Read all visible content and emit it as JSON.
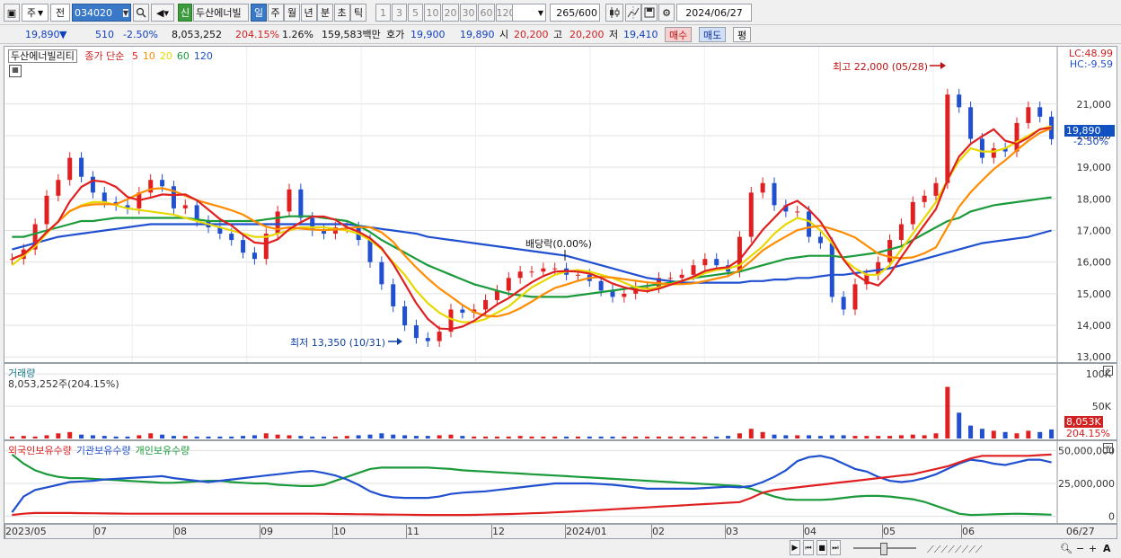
{
  "toolbar": {
    "period_week": "주",
    "prev_label": "전",
    "code": "034020",
    "new_badge": "신",
    "stock_name": "두산에너빌",
    "periods": [
      "일",
      "주",
      "월",
      "년",
      "분",
      "초",
      "틱"
    ],
    "active_period": "일",
    "intervals": [
      "1",
      "3",
      "5",
      "10",
      "20",
      "30",
      "60",
      "120"
    ],
    "count_value": "265",
    "count_max": "/600",
    "date": "2024/06/27"
  },
  "infobar": {
    "price": "19,890",
    "arrow": "▼",
    "change": "510",
    "change_pct": "-2.50%",
    "volume": "8,053,252",
    "volume_ratio": "204.15%",
    "turnover_pct": "1.26%",
    "trade_value": "159,583백만",
    "quote_label": "호가",
    "ask": "19,900",
    "bid": "19,890",
    "open_label": "시",
    "open": "20,200",
    "high_label": "고",
    "high": "20,200",
    "low_label": "저",
    "low": "19,410",
    "buy_button": "매수",
    "sell_button": "매도",
    "eval_button": "평"
  },
  "price_pane": {
    "stock_label": "두산에너빌리티",
    "legend_prefix": "종가 단순",
    "ma_labels": [
      "5",
      "10",
      "20",
      "60",
      "120"
    ],
    "ma_colors": [
      "#e02020",
      "#ff8c00",
      "#e8d800",
      "#1a9a3a",
      "#2050d0"
    ],
    "lc": "LC:48.99",
    "hc": "HC:-9.59",
    "high_annotation": "최고 22,000 (05/28)",
    "low_annotation": "최저 13,350 (10/31)",
    "dividend_annotation": "배당락(0.00%)",
    "current_price_tag": "19,890",
    "current_pct_tag": "-2.50%"
  },
  "volume_pane": {
    "title": "거래량",
    "value": "8,053,252주(204.15%)",
    "current_tag": "8,053K",
    "current_pct": "204.15%"
  },
  "holding_pane": {
    "legend": [
      "외국인보유수량",
      "기관보유수량",
      "개인보유수량"
    ],
    "colors": [
      "#e02020",
      "#2050d0",
      "#1a9a3a"
    ]
  },
  "x_labels": [
    "2023/05",
    "07",
    "08",
    "09",
    "10",
    "11",
    "12",
    "2024/01",
    "02",
    "03",
    "04",
    "05",
    "06",
    "06/27"
  ],
  "chart_data": [
    {
      "type": "line",
      "name": "price",
      "y_ticks": [
        13000,
        14000,
        15000,
        16000,
        17000,
        18000,
        19000,
        20000,
        21000
      ],
      "ylim": [
        12950,
        22700
      ],
      "close": [
        16100,
        16400,
        17200,
        18100,
        18600,
        19300,
        18700,
        18200,
        17900,
        17800,
        17700,
        18200,
        18600,
        18400,
        17700,
        17800,
        17300,
        17100,
        16900,
        16700,
        16300,
        16100,
        16900,
        17600,
        18300,
        17400,
        17000,
        16900,
        17100,
        17100,
        16700,
        16000,
        15300,
        14600,
        14000,
        13600,
        13500,
        13800,
        14500,
        14400,
        14500,
        14800,
        15100,
        15500,
        15700,
        15700,
        15800,
        15800,
        15600,
        15600,
        15400,
        15100,
        14900,
        15000,
        15200,
        15200,
        15500,
        15500,
        15600,
        15900,
        16100,
        15900,
        15700,
        16800,
        18200,
        18500,
        17800,
        17600,
        17600,
        16800,
        16600,
        14900,
        14500,
        15300,
        15600,
        16000,
        16700,
        17200,
        17900,
        18100,
        18500,
        21300,
        20900,
        19900,
        19300,
        19600,
        19500,
        20400,
        20900,
        20600,
        19890
      ],
      "ma20": [
        15900,
        16200,
        16500,
        16900,
        17300,
        17600,
        17800,
        17900,
        17900,
        17800,
        17700,
        17650,
        17600,
        17550,
        17500,
        17400,
        17300,
        17200,
        17100,
        17000,
        16900,
        16800,
        16800,
        16900,
        17000,
        17100,
        17100,
        17100,
        17050,
        17000,
        16900,
        16700,
        16400,
        16000,
        15600,
        15100,
        14700,
        14400,
        14200,
        14100,
        14100,
        14200,
        14400,
        14600,
        14900,
        15200,
        15400,
        15600,
        15700,
        15750,
        15700,
        15600,
        15500,
        15350,
        15200,
        15150,
        15200,
        15300,
        15400,
        15500,
        15650,
        15750,
        15800,
        15900,
        16200,
        16500,
        16900,
        17200,
        17400,
        17300,
        17000,
        16600,
        16100,
        15800,
        15600,
        15600,
        15900,
        16400,
        16900,
        17400,
        17900,
        18600,
        19200,
        19600,
        19500,
        19500,
        19600,
        19800,
        20000,
        20200,
        20300
      ],
      "ma60": [
        16800,
        16800,
        16900,
        17000,
        17100,
        17200,
        17300,
        17300,
        17350,
        17400,
        17400,
        17400,
        17400,
        17400,
        17400,
        17400,
        17350,
        17300,
        17300,
        17300,
        17300,
        17300,
        17350,
        17400,
        17450,
        17450,
        17450,
        17400,
        17350,
        17300,
        17150,
        16950,
        16700,
        16500,
        16300,
        16100,
        15900,
        15750,
        15600,
        15450,
        15300,
        15200,
        15100,
        15000,
        14950,
        14900,
        14900,
        14900,
        14900,
        14950,
        15000,
        15050,
        15100,
        15150,
        15200,
        15250,
        15300,
        15350,
        15400,
        15500,
        15550,
        15600,
        15650,
        15700,
        15800,
        15900,
        16000,
        16100,
        16150,
        16200,
        16200,
        16200,
        16150,
        16200,
        16250,
        16300,
        16400,
        16500,
        16700,
        16900,
        17100,
        17300,
        17400,
        17600,
        17700,
        17800,
        17850,
        17900,
        17950,
        18000,
        18050
      ],
      "ma120": [
        16400,
        16500,
        16600,
        16700,
        16800,
        16850,
        16900,
        16950,
        17000,
        17050,
        17100,
        17150,
        17200,
        17200,
        17200,
        17200,
        17200,
        17200,
        17200,
        17200,
        17200,
        17200,
        17200,
        17200,
        17200,
        17200,
        17200,
        17200,
        17200,
        17200,
        17150,
        17100,
        17050,
        17000,
        16950,
        16900,
        16800,
        16750,
        16700,
        16650,
        16600,
        16550,
        16500,
        16450,
        16400,
        16350,
        16300,
        16250,
        16200,
        16100,
        16000,
        15900,
        15800,
        15700,
        15600,
        15500,
        15450,
        15400,
        15350,
        15350,
        15350,
        15350,
        15350,
        15350,
        15400,
        15400,
        15450,
        15450,
        15500,
        15500,
        15550,
        15600,
        15600,
        15650,
        15700,
        15750,
        15800,
        15900,
        16000,
        16100,
        16200,
        16300,
        16400,
        16500,
        16600,
        16650,
        16700,
        16750,
        16800,
        16900,
        17000
      ]
    },
    {
      "type": "bar",
      "name": "volume",
      "y_ticks": [
        0,
        50000,
        100000
      ],
      "ylim": [
        0,
        110000
      ],
      "values": [
        3,
        4,
        3,
        5,
        8,
        10,
        6,
        5,
        4,
        3,
        3,
        5,
        8,
        6,
        4,
        4,
        3,
        3,
        3,
        3,
        4,
        5,
        8,
        6,
        5,
        4,
        3,
        3,
        3,
        4,
        5,
        6,
        8,
        6,
        5,
        4,
        4,
        5,
        6,
        4,
        3,
        3,
        3,
        3,
        4,
        3,
        3,
        3,
        3,
        3,
        3,
        3,
        3,
        3,
        3,
        3,
        3,
        3,
        3,
        3,
        3,
        3,
        4,
        8,
        15,
        10,
        6,
        5,
        5,
        5,
        4,
        5,
        5,
        4,
        4,
        4,
        4,
        5,
        6,
        5,
        8,
        80,
        40,
        20,
        15,
        12,
        10,
        8,
        12,
        10,
        14
      ]
    },
    {
      "type": "line",
      "name": "holdings",
      "y_ticks": [
        0,
        25000000,
        50000000
      ],
      "ylim": [
        -3000000,
        53000000
      ],
      "foreign": [
        1000000,
        2000000,
        2500000,
        2500000,
        2500000,
        2500000,
        2400000,
        2300000,
        2200000,
        2100000,
        2000000,
        2000000,
        2000000,
        2000000,
        2000000,
        2000000,
        2000000,
        2000000,
        2000000,
        2000000,
        2000000,
        2000000,
        2000000,
        2000000,
        2000000,
        2000000,
        2000000,
        1900000,
        1800000,
        1700000,
        1600000,
        1500000,
        1400000,
        1300000,
        1200000,
        1100000,
        1000000,
        1000000,
        1000000,
        1000000,
        1100000,
        1300000,
        1500000,
        1700000,
        2000000,
        2300000,
        2600000,
        3000000,
        3400000,
        3800000,
        4300000,
        4800000,
        5300000,
        5800000,
        6300000,
        6800000,
        7300000,
        7800000,
        8300000,
        8800000,
        9300000,
        9800000,
        10300000,
        10800000,
        14000000,
        18000000,
        20000000,
        21000000,
        22000000,
        23000000,
        24000000,
        25000000,
        26000000,
        27000000,
        28000000,
        29000000,
        30000000,
        31000000,
        32000000,
        34000000,
        36000000,
        38000000,
        41000000,
        44000000,
        46000000,
        46000000,
        46000000,
        46000000,
        46000000,
        46500000,
        47000000
      ],
      "institution": [
        3000000,
        15000000,
        20000000,
        22000000,
        24000000,
        26000000,
        26500000,
        27000000,
        28000000,
        28500000,
        29000000,
        29500000,
        30000000,
        30500000,
        29000000,
        28000000,
        27000000,
        26000000,
        27000000,
        28000000,
        29000000,
        30000000,
        31000000,
        32000000,
        33000000,
        34000000,
        34500000,
        33000000,
        31000000,
        28000000,
        24000000,
        19000000,
        16000000,
        14500000,
        14000000,
        14000000,
        14000000,
        15000000,
        17000000,
        18000000,
        18500000,
        19000000,
        20000000,
        21000000,
        22000000,
        23000000,
        24000000,
        25000000,
        25000000,
        25000000,
        25000000,
        24500000,
        24000000,
        23000000,
        22000000,
        21000000,
        21000000,
        21000000,
        21000000,
        21000000,
        21500000,
        22000000,
        22500000,
        22000000,
        23000000,
        26000000,
        30000000,
        35000000,
        42000000,
        45000000,
        46000000,
        44000000,
        40000000,
        36000000,
        34000000,
        30000000,
        27000000,
        26000000,
        27000000,
        29000000,
        32000000,
        36000000,
        40000000,
        43000000,
        42000000,
        40000000,
        39000000,
        41000000,
        43000000,
        43000000,
        41000000
      ],
      "individual": [
        47000000,
        40000000,
        35000000,
        32000000,
        30000000,
        29000000,
        29000000,
        28500000,
        28000000,
        27500000,
        27000000,
        26500000,
        26000000,
        25500000,
        25500000,
        26000000,
        26500000,
        27000000,
        27000000,
        26000000,
        25500000,
        25000000,
        25000000,
        24000000,
        23500000,
        23000000,
        23000000,
        24000000,
        27000000,
        30000000,
        33000000,
        36000000,
        37000000,
        37000000,
        37000000,
        37000000,
        37000000,
        36500000,
        36000000,
        35000000,
        34500000,
        34000000,
        33500000,
        33000000,
        32500000,
        32000000,
        31500000,
        31000000,
        30500000,
        30000000,
        29500000,
        29000000,
        28500000,
        28000000,
        27500000,
        27000000,
        26500000,
        26000000,
        25500000,
        25000000,
        24500000,
        24000000,
        23500000,
        23000000,
        21000000,
        18000000,
        15000000,
        13000000,
        12500000,
        12500000,
        12500000,
        13000000,
        14000000,
        15000000,
        15500000,
        15500000,
        15000000,
        14000000,
        13000000,
        11000000,
        8000000,
        5000000,
        2000000,
        1000000,
        1200000,
        1500000,
        1800000,
        2000000,
        1800000,
        1500000,
        1200000
      ]
    }
  ]
}
